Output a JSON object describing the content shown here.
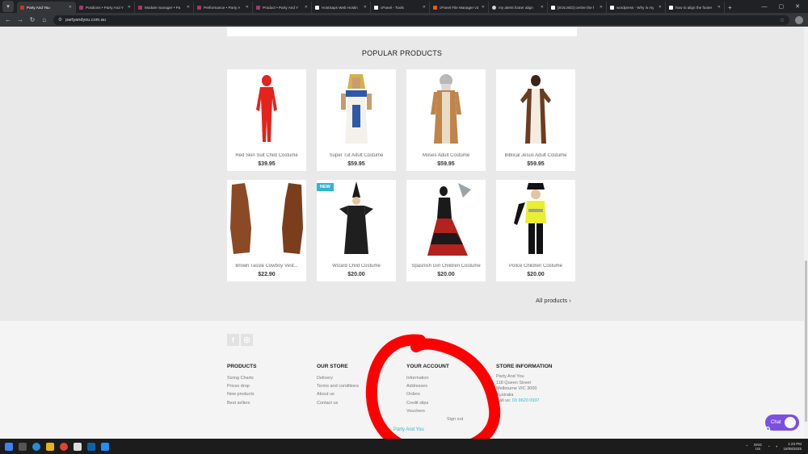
{
  "browser": {
    "tabs": [
      {
        "title": "Party And You",
        "active": true
      },
      {
        "title": "Positions • Party And Y"
      },
      {
        "title": "Module manager • Pa"
      },
      {
        "title": "Performance • Party A"
      },
      {
        "title": "Product • Party And Y"
      },
      {
        "title": "HostSaps Web Hostin"
      },
      {
        "title": "cPanel - Tools"
      },
      {
        "title": "cPanel File Manager v3"
      },
      {
        "title": "my alerts footer align"
      },
      {
        "title": "[SOLVED] centre the f"
      },
      {
        "title": "wordpress - Why is my"
      },
      {
        "title": "how to align the footer"
      }
    ],
    "url": "partyandyou.com.au"
  },
  "page": {
    "section_title": "POPULAR PRODUCTS",
    "all_products": "All products",
    "new_badge": "NEW",
    "products": [
      {
        "name": "Red Skin Suit Child Costume",
        "price": "$39.95"
      },
      {
        "name": "Super Tut Adult Costume",
        "price": "$59.95"
      },
      {
        "name": "Moses Adult Costume",
        "price": "$59.95"
      },
      {
        "name": "Biblical Jesus Adult Costume",
        "price": "$59.95"
      },
      {
        "name": "Brown Tassle Cowboy Vest...",
        "price": "$22.90"
      },
      {
        "name": "Wizard Child Costume",
        "price": "$20.00"
      },
      {
        "name": "Spasnish Girl Children Costume",
        "price": "$20.00"
      },
      {
        "name": "Police Children Costume",
        "price": "$20.00"
      }
    ]
  },
  "footer": {
    "social": [
      "f",
      "◎"
    ],
    "products": {
      "title": "PRODUCTS",
      "links": [
        "Sizing Charts",
        "Prices drop",
        "New products",
        "Best sellers"
      ]
    },
    "our_store": {
      "title": "OUR STORE",
      "links": [
        "Delivery",
        "Terms and conditions",
        "About us",
        "Contact us"
      ]
    },
    "your_account": {
      "title": "YOUR ACCOUNT",
      "links": [
        "Information",
        "Addresses",
        "Orders",
        "Credit slips",
        "Vouchers"
      ],
      "sign_out": "Sign out"
    },
    "store_info": {
      "title": "STORE INFORMATION",
      "lines": [
        "Party And You",
        "118 Queen Street",
        "Melbourne VIC 3000",
        "Australia"
      ],
      "call_label": "Call us:",
      "phone": "03 9620 0937"
    },
    "copyright": "Party And You"
  },
  "chat": {
    "label": "Chat"
  },
  "taskbar": {
    "lang": "ENG",
    "region": "US",
    "time": "1:23 PM",
    "date": "18/08/2025"
  },
  "colors": {
    "accent": "#2fb5d2",
    "chat": "#7b4fe0",
    "annotation": "#ff0000"
  }
}
